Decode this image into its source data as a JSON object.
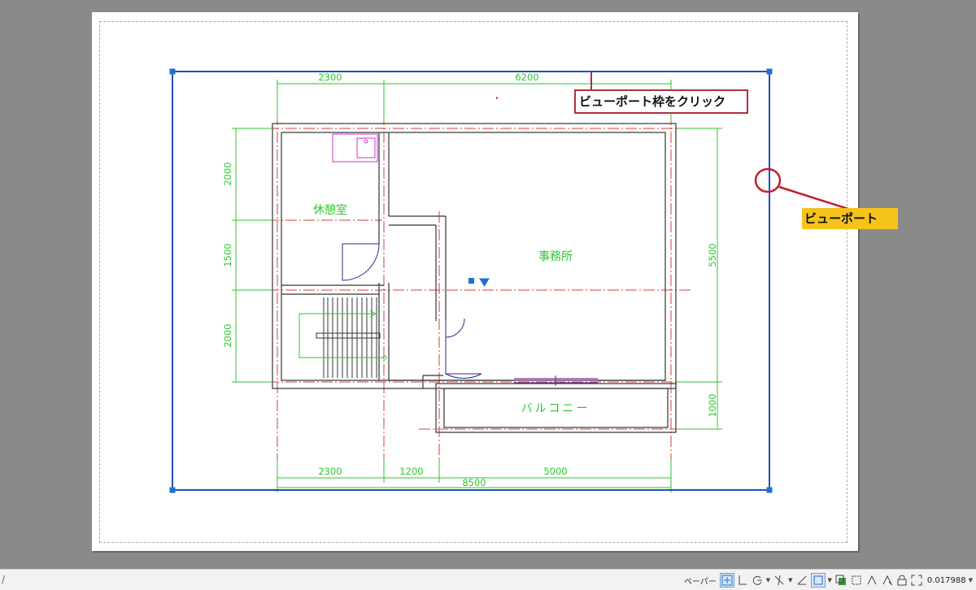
{
  "drawing": {
    "rooms": {
      "rest_room": "休憩室",
      "office": "事務所",
      "balcony": "バルコニー"
    },
    "dims_top": [
      "2300",
      "6200"
    ],
    "dims_left": [
      "2000",
      "1500",
      "2000"
    ],
    "dims_right": [
      "5500",
      "1000"
    ],
    "dims_bottom": [
      "2300",
      "1200",
      "5000"
    ],
    "dim_total": "8500"
  },
  "annotations": {
    "click_viewport_frame": "ビューポート枠をクリック",
    "viewport": "ビューポート"
  },
  "statusbar": {
    "space_label": "ペーパー",
    "scale_value": "0.017988",
    "left_mark": "/"
  },
  "colors": {
    "viewport_border": "#1f4fb8",
    "dimension": "#2ec62e",
    "wall": "#333333",
    "centerline": "#d63c3c",
    "callout_border": "#b03040",
    "callout_fill": "#f6c21c",
    "fixture": "#cc33cc",
    "door": "#2a2a8a"
  },
  "icons": [
    "grid-snap-icon",
    "ortho-icon",
    "polar-icon",
    "osnap-icon",
    "lineweight-icon",
    "viewport-icon",
    "annotation-scale-icon",
    "lock-icon",
    "fullscreen-icon"
  ]
}
